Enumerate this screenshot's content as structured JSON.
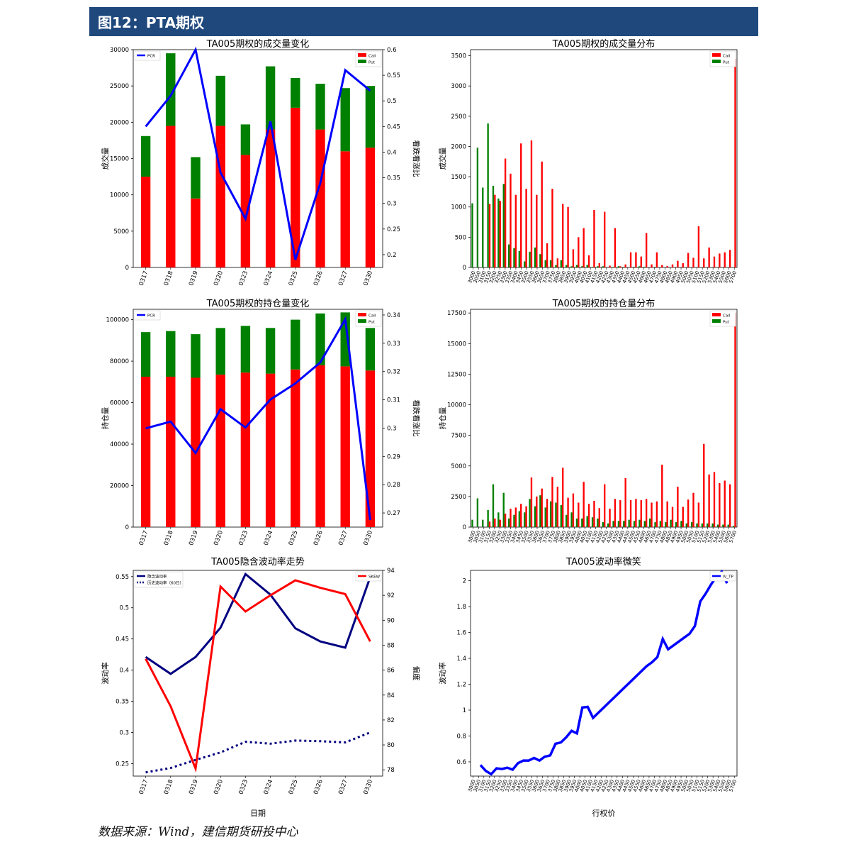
{
  "header": {
    "title": "图12：PTA期权"
  },
  "footer": {
    "source": "数据来源：Wind，建信期货研投中心"
  },
  "colors": {
    "header_bg": "#1F497D",
    "call": "#FF0000",
    "put": "#008000",
    "pcr": "#0000FF",
    "navy": "#000080"
  },
  "chart_data": [
    {
      "id": "vol-change",
      "type": "bar",
      "title": "TA005期权的成交量变化",
      "ylabel": "成交量",
      "y2label": "看跌看涨比",
      "categories": [
        "0317",
        "0318",
        "0319",
        "0320",
        "0323",
        "0324",
        "0325",
        "0326",
        "0327",
        "0330"
      ],
      "ylim": [
        0,
        30000
      ],
      "yticks": [
        0,
        5000,
        10000,
        15000,
        20000,
        25000,
        30000
      ],
      "y2lim": [
        0.175,
        0.6
      ],
      "y2ticks": [
        0.2,
        0.25,
        0.3,
        0.35,
        0.4,
        0.45,
        0.5,
        0.55,
        0.6
      ],
      "series": [
        {
          "name": "Call",
          "kind": "bar",
          "values": [
            12500,
            19500,
            9500,
            19500,
            15500,
            19000,
            22000,
            19000,
            16000,
            16500
          ]
        },
        {
          "name": "Put",
          "kind": "bar",
          "values": [
            5600,
            10000,
            5700,
            6900,
            4200,
            8700,
            4100,
            6300,
            8700,
            8500
          ]
        },
        {
          "name": "PCR",
          "kind": "line",
          "axis": "right",
          "values": [
            0.45,
            0.51,
            0.6,
            0.36,
            0.27,
            0.46,
            0.19,
            0.34,
            0.56,
            0.52
          ]
        }
      ],
      "legend_left": [
        "PCR"
      ],
      "legend_right": [
        "Call",
        "Put"
      ]
    },
    {
      "id": "vol-dist",
      "type": "bar",
      "title": "TA005期权的成交量分布",
      "ylabel": "成交量",
      "categories": [
        "3000",
        "3050",
        "3100",
        "3150",
        "3200",
        "3250",
        "3300",
        "3350",
        "3400",
        "3450",
        "3500",
        "3550",
        "3600",
        "3650",
        "3700",
        "3750",
        "3800",
        "3850",
        "3900",
        "3950",
        "4000",
        "4050",
        "4100",
        "4150",
        "4200",
        "4250",
        "4300",
        "4350",
        "4400",
        "4450",
        "4500",
        "4550",
        "4600",
        "4650",
        "4700",
        "4750",
        "4800",
        "4850",
        "4900",
        "4950",
        "5000",
        "5050",
        "5100",
        "5150",
        "5200",
        "5300",
        "5400",
        "5500",
        "5600",
        "5700"
      ],
      "ylim": [
        0,
        3600
      ],
      "yticks": [
        0,
        500,
        1000,
        1500,
        2000,
        2500,
        3000,
        3500
      ],
      "series": [
        {
          "name": "Call",
          "values": [
            0,
            0,
            0,
            1050,
            1200,
            1100,
            1800,
            1550,
            1200,
            2050,
            1300,
            2100,
            1200,
            1750,
            400,
            1300,
            150,
            1050,
            1000,
            300,
            500,
            650,
            200,
            950,
            70,
            920,
            30,
            650,
            20,
            50,
            250,
            250,
            180,
            570,
            50,
            250,
            40,
            25,
            50,
            110,
            70,
            240,
            160,
            680,
            150,
            330,
            180,
            230,
            250,
            290,
            3450
          ]
        },
        {
          "name": "Put",
          "values": [
            1060,
            1980,
            1320,
            2380,
            1350,
            1140,
            1380,
            380,
            320,
            270,
            100,
            260,
            330,
            220,
            120,
            120,
            40,
            120,
            40,
            20,
            40,
            20,
            40,
            10,
            20,
            20,
            0,
            10,
            20,
            10,
            0,
            10,
            20,
            10,
            0,
            10,
            0,
            0,
            0,
            0,
            0,
            0,
            0,
            0,
            0,
            0,
            0,
            0,
            0,
            0,
            0
          ]
        }
      ],
      "legend_right": [
        "Call",
        "Put"
      ]
    },
    {
      "id": "oi-change",
      "type": "bar",
      "title": "TA005期权的持仓量变化",
      "ylabel": "持仓量",
      "y2label": "看跌看涨比",
      "categories": [
        "0317",
        "0318",
        "0319",
        "0320",
        "0323",
        "0324",
        "0325",
        "0326",
        "0327",
        "0330"
      ],
      "ylim": [
        0,
        105000
      ],
      "yticks": [
        0,
        20000,
        40000,
        60000,
        80000,
        100000
      ],
      "y2lim": [
        0.265,
        0.342
      ],
      "y2ticks": [
        0.27,
        0.28,
        0.29,
        0.3,
        0.31,
        0.32,
        0.33,
        0.34
      ],
      "series": [
        {
          "name": "Call",
          "kind": "bar",
          "values": [
            72500,
            72500,
            72000,
            73500,
            74500,
            74000,
            76000,
            78000,
            77500,
            75500
          ]
        },
        {
          "name": "Put",
          "kind": "bar",
          "values": [
            21500,
            22000,
            21000,
            22500,
            22500,
            22000,
            24000,
            25000,
            26000,
            20500
          ]
        },
        {
          "name": "PCR",
          "kind": "line",
          "axis": "right",
          "values": [
            0.2999,
            0.3023,
            0.2912,
            0.3067,
            0.3002,
            0.3101,
            0.3158,
            0.3232,
            0.3385,
            0.2675
          ]
        }
      ],
      "legend_left": [
        "PCR"
      ],
      "legend_right": [
        "Call",
        "Put"
      ]
    },
    {
      "id": "oi-dist",
      "type": "bar",
      "title": "TA005期权的持仓量分布",
      "ylabel": "持仓量",
      "categories": [
        "3000",
        "3050",
        "3100",
        "3150",
        "3200",
        "3250",
        "3300",
        "3350",
        "3400",
        "3450",
        "3500",
        "3550",
        "3600",
        "3650",
        "3700",
        "3750",
        "3800",
        "3850",
        "3900",
        "3950",
        "4000",
        "4050",
        "4100",
        "4150",
        "4200",
        "4250",
        "4300",
        "4350",
        "4400",
        "4450",
        "4500",
        "4550",
        "4600",
        "4650",
        "4700",
        "4750",
        "4800",
        "4850",
        "4900",
        "4950",
        "5000",
        "5050",
        "5100",
        "5150",
        "5200",
        "5300",
        "5400",
        "5500",
        "5600",
        "5700"
      ],
      "ylim": [
        0,
        17800
      ],
      "yticks": [
        0,
        2500,
        5000,
        7500,
        10000,
        12500,
        15000,
        17500
      ],
      "series": [
        {
          "name": "Call",
          "values": [
            0,
            0,
            0,
            450,
            700,
            600,
            1100,
            1500,
            1600,
            1900,
            1700,
            4050,
            2500,
            3150,
            2300,
            4100,
            3300,
            4850,
            2400,
            2750,
            2000,
            3700,
            1900,
            2150,
            1550,
            3500,
            1500,
            2300,
            2200,
            4000,
            2200,
            2300,
            2200,
            2300,
            2000,
            2100,
            5100,
            2100,
            1650,
            3300,
            1650,
            2250,
            2800,
            2000,
            6800,
            4300,
            4500,
            3600,
            3800,
            3500,
            17500
          ]
        },
        {
          "name": "Put",
          "values": [
            600,
            2350,
            600,
            1400,
            3500,
            1200,
            2800,
            700,
            1000,
            1300,
            1200,
            2300,
            1700,
            2600,
            1600,
            2100,
            2000,
            1800,
            1000,
            1200,
            700,
            700,
            900,
            800,
            700,
            400,
            300,
            500,
            500,
            500,
            600,
            500,
            600,
            500,
            700,
            400,
            500,
            400,
            600,
            400,
            500,
            300,
            400,
            300,
            300,
            300,
            300,
            200,
            200,
            200,
            100
          ]
        }
      ],
      "legend_right": [
        "Call",
        "Put"
      ]
    },
    {
      "id": "iv-trend",
      "type": "line",
      "title": "TA005隐含波动率走势",
      "xlabel": "日期",
      "ylabel": "波动率",
      "y2label": "偏度",
      "categories": [
        "0317",
        "0318",
        "0319",
        "0320",
        "0323",
        "0324",
        "0325",
        "0326",
        "0327",
        "0330"
      ],
      "ylim": [
        0.23,
        0.56
      ],
      "yticks": [
        0.25,
        0.3,
        0.35,
        0.4,
        0.45,
        0.5,
        0.55
      ],
      "y2lim": [
        77.5,
        94
      ],
      "y2ticks": [
        78,
        80,
        82,
        84,
        86,
        88,
        90,
        92,
        94
      ],
      "series": [
        {
          "name": "隐含波动率",
          "style": "solid",
          "color": "navy",
          "axis": "left",
          "values": [
            0.421,
            0.394,
            0.421,
            0.468,
            0.554,
            0.521,
            0.467,
            0.446,
            0.436,
            0.549
          ]
        },
        {
          "name": "历史波动率（60日）",
          "style": "dotted",
          "color": "navy",
          "axis": "left",
          "values": [
            0.236,
            0.243,
            0.256,
            0.268,
            0.285,
            0.282,
            0.287,
            0.286,
            0.284,
            0.3
          ]
        },
        {
          "name": "SKEW",
          "style": "solid",
          "color": "red",
          "axis": "right",
          "values": [
            86.9,
            83.1,
            78.1,
            92.7,
            90.7,
            92,
            93.2,
            92.6,
            92.1,
            88.3
          ]
        }
      ],
      "legend_left": [
        "隐含波动率",
        "历史波动率（60日）"
      ],
      "legend_right": [
        "SKEW"
      ]
    },
    {
      "id": "vol-smile",
      "type": "line",
      "title": "TA005波动率微笑",
      "xlabel": "行权价",
      "ylabel": "波动率",
      "categories": [
        "3000",
        "3050",
        "3100",
        "3150",
        "3200",
        "3250",
        "3300",
        "3350",
        "3400",
        "3450",
        "3500",
        "3550",
        "3600",
        "3650",
        "3700",
        "3750",
        "3800",
        "3850",
        "3900",
        "3950",
        "4000",
        "4050",
        "4100",
        "4150",
        "4200",
        "4250",
        "4300",
        "4350",
        "4400",
        "4450",
        "4500",
        "4550",
        "4600",
        "4650",
        "4700",
        "4750",
        "4800",
        "4850",
        "4900",
        "4950",
        "5000",
        "5050",
        "5100",
        "5150",
        "5200",
        "5300",
        "5400",
        "5500",
        "5600",
        "5700"
      ],
      "ylim": [
        0.49,
        2.08
      ],
      "yticks": [
        0.6,
        0.8,
        1.0,
        1.2,
        1.4,
        1.6,
        1.8,
        2.0
      ],
      "series": [
        {
          "name": "IV_TP",
          "values": [
            0.575,
            0.53,
            0.505,
            0.55,
            0.545,
            0.555,
            0.54,
            0.59,
            0.61,
            0.61,
            0.63,
            0.61,
            0.64,
            0.65,
            0.74,
            0.75,
            0.79,
            0.84,
            0.82,
            1.02,
            1.025,
            0.94,
            0.98,
            1.02,
            1.06,
            1.1,
            1.14,
            1.18,
            1.22,
            1.26,
            1.3,
            1.34,
            1.37,
            1.41,
            1.55,
            1.47,
            1.5,
            1.53,
            1.56,
            1.59,
            1.65,
            1.84,
            1.9,
            1.97,
            2.03,
            2.07,
            1.98
          ]
        }
      ],
      "legend_right": [
        "IV_TP"
      ]
    }
  ]
}
